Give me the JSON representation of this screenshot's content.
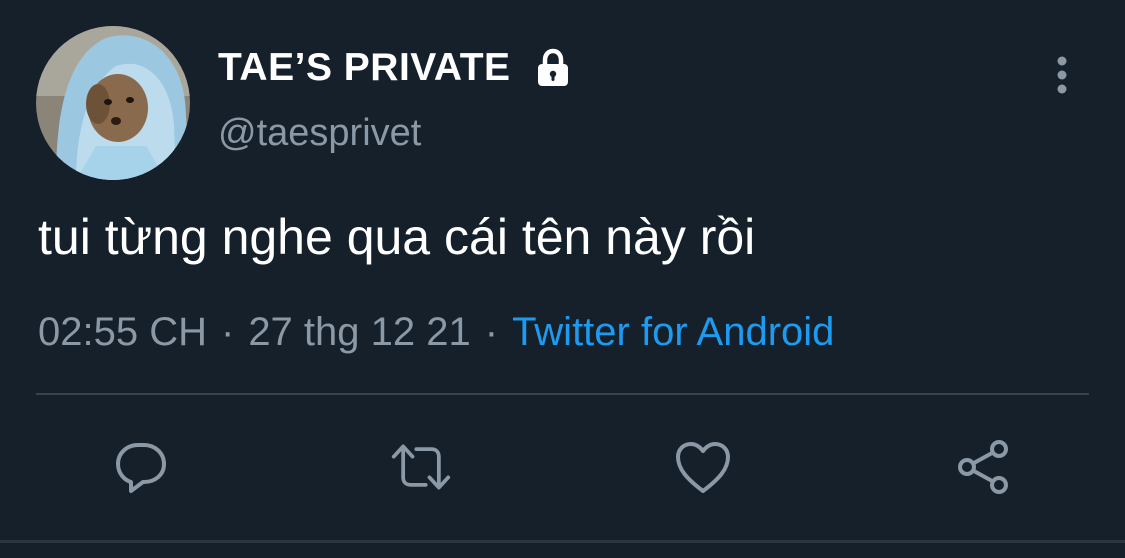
{
  "tweet": {
    "display_name": "TAE’S PRIVATE",
    "handle": "@taesprivet",
    "text": "tui từng nghe qua cái tên này rồi",
    "time": "02:55 CH",
    "date": "27 thg 12 21",
    "separator": "·",
    "source": "Twitter for Android"
  },
  "icons": {
    "lock": "lock-icon",
    "more": "more-vertical-icon",
    "reply": "reply-icon",
    "retweet": "retweet-icon",
    "like": "heart-icon",
    "share": "share-icon"
  },
  "colors": {
    "background": "#15202b",
    "primary_text": "#ffffff",
    "secondary_text": "#8b98a5",
    "link": "#1d9bf0",
    "divider": "#38444d"
  }
}
